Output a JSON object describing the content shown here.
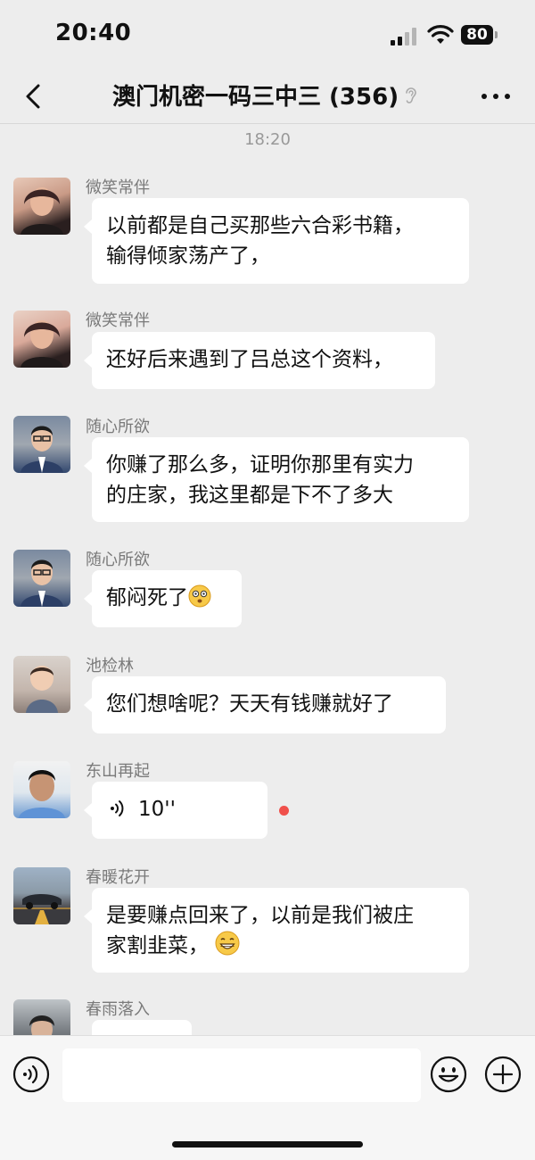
{
  "status_bar": {
    "time": "20:40",
    "battery": "80"
  },
  "header": {
    "title": "澳门机密一码三中三 (356)"
  },
  "chat": {
    "timestamp": "18:20"
  },
  "messages": [
    {
      "sender": "微笑常伴",
      "lines": [
        "以前都是自己买那些六合彩书籍，",
        "输得倾家荡产了，"
      ]
    },
    {
      "sender": "微笑常伴",
      "lines": [
        "还好后来遇到了吕总这个资料，"
      ]
    },
    {
      "sender": "随心所欲",
      "lines": [
        "你赚了那么多，证明你那里有实力",
        "的庄家，我这里都是下不了多大"
      ]
    },
    {
      "sender": "随心所欲",
      "text": "郁闷死了"
    },
    {
      "sender": "池检林",
      "text": "您们想啥呢？天天有钱赚就好了"
    },
    {
      "sender": "东山再起",
      "voice_duration": "10''"
    },
    {
      "sender": "春暖花开",
      "line1": "是要赚点回来了，以前是我们被庄",
      "line2": "家割韭菜，"
    },
    {
      "sender": "春雨落入"
    }
  ],
  "input": {
    "placeholder": ""
  },
  "icons": {
    "back": "chevron-left-icon",
    "mute": "ear-mute-icon",
    "more": "more-dots-icon",
    "voice": "voice-icon",
    "emoji": "smiley-icon",
    "plus": "plus-icon"
  }
}
